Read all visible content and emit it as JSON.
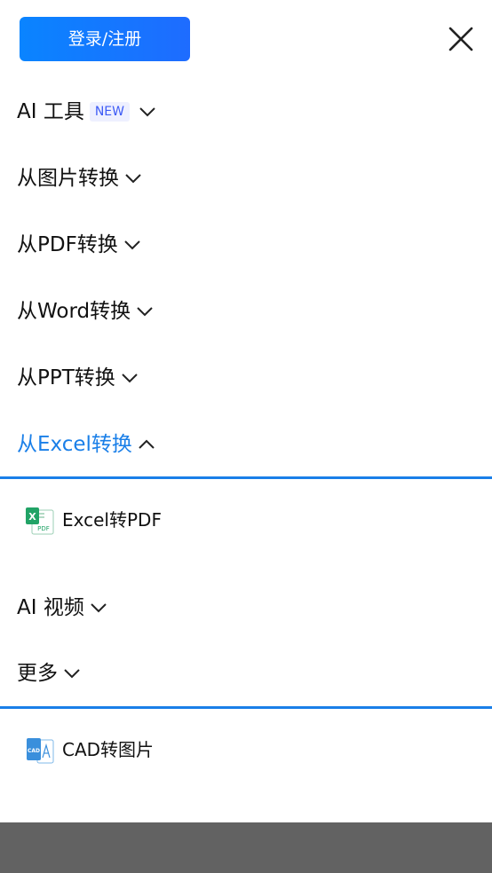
{
  "header": {
    "login_label": "登录/注册"
  },
  "menu": {
    "ai_tools": {
      "label": "AI 工具",
      "badge": "NEW"
    },
    "from_image": {
      "label": "从图片转换"
    },
    "from_pdf": {
      "label": "从PDF转换"
    },
    "from_word": {
      "label": "从Word转换"
    },
    "from_ppt": {
      "label": "从PPT转换"
    },
    "from_excel": {
      "label": "从Excel转换",
      "expanded": true
    },
    "excel_sub": [
      {
        "label": "Excel转PDF",
        "icon": "excel-to-pdf-icon"
      }
    ],
    "ai_video": {
      "label": "AI 视频"
    },
    "more": {
      "label": "更多",
      "expanded": true
    },
    "more_sub": [
      {
        "label": "CAD转图片",
        "icon": "cad-to-image-icon"
      }
    ]
  },
  "colors": {
    "accent": "#1a7fe8",
    "login_gradient_start": "#0a84ff",
    "login_gradient_end": "#1e6cff",
    "badge_text": "#3d5bf5",
    "badge_bg": "#eef0ff",
    "bottom_bar": "#626262"
  }
}
